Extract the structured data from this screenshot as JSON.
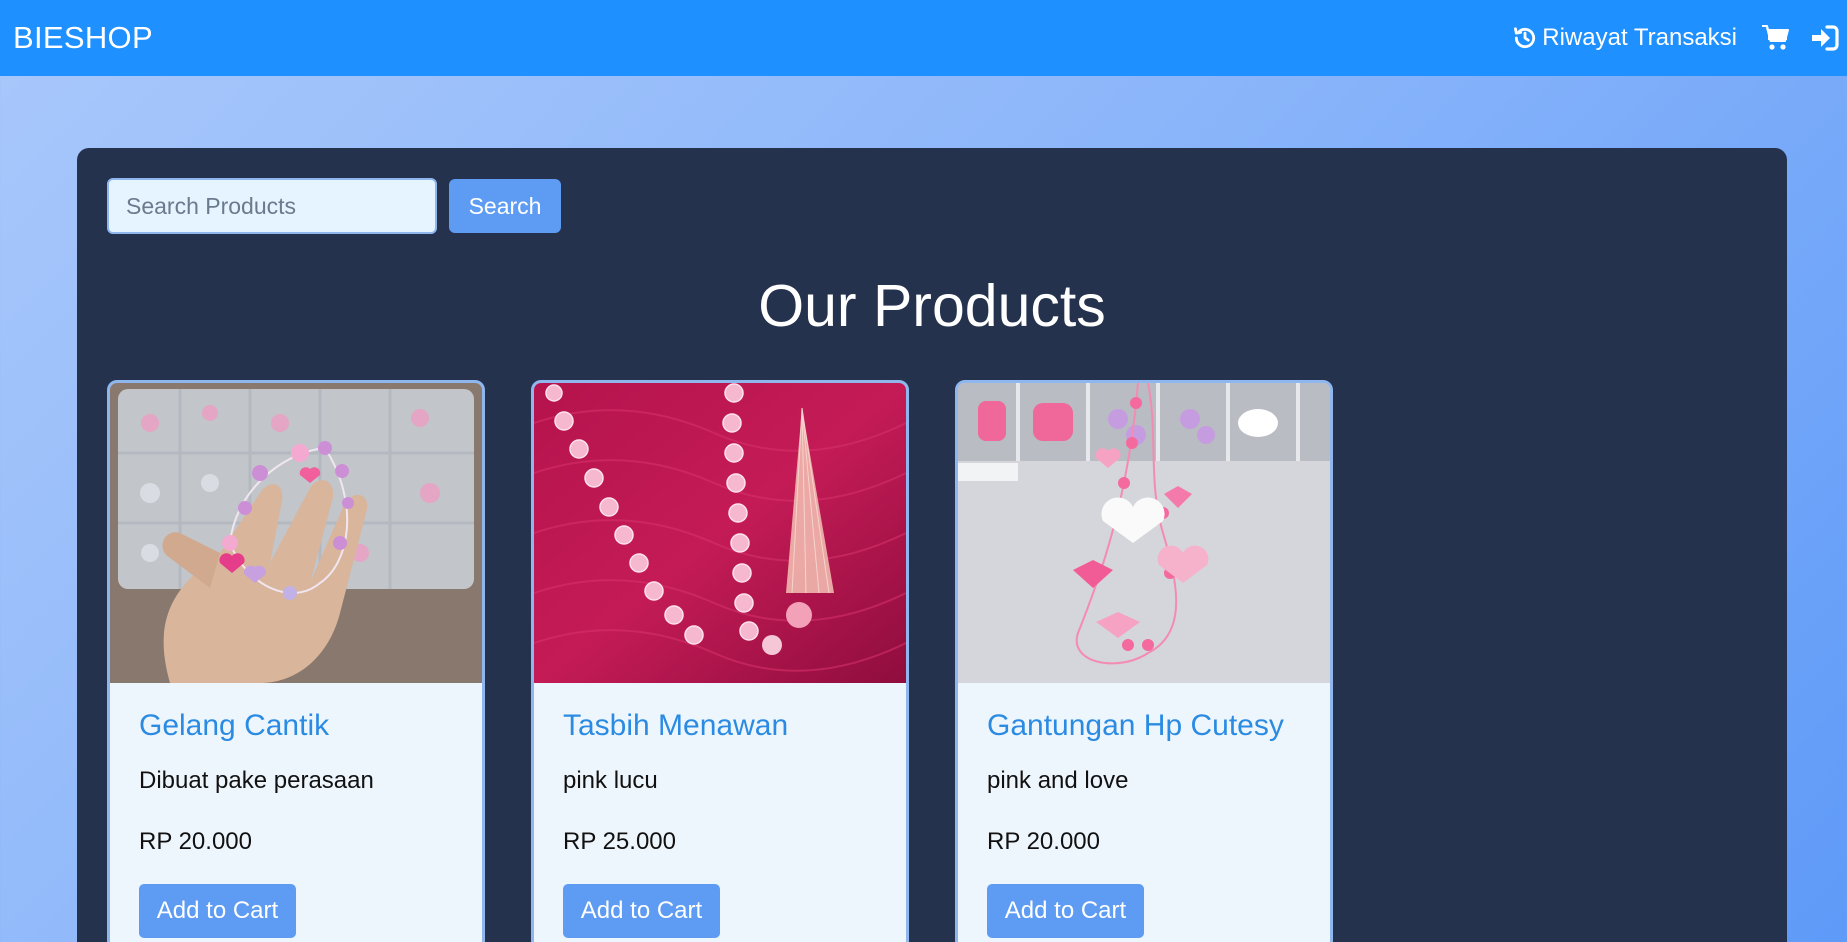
{
  "navbar": {
    "brand": "BIESHOP",
    "history_label": "Riwayat Transaksi",
    "history_icon": "history-icon",
    "cart_icon": "cart-icon",
    "login_icon": "sign-in-icon"
  },
  "search": {
    "placeholder": "Search Products",
    "value": "",
    "button_label": "Search"
  },
  "main": {
    "title": "Our Products"
  },
  "products": [
    {
      "name": "Gelang Cantik",
      "description": "Dibuat pake perasaan",
      "price": "RP 20.000",
      "button": "Add to Cart"
    },
    {
      "name": "Tasbih Menawan",
      "description": "pink lucu",
      "price": "RP 25.000",
      "button": "Add to Cart"
    },
    {
      "name": "Gantungan Hp Cutesy",
      "description": "pink and love",
      "price": "RP 20.000",
      "button": "Add to Cart"
    }
  ],
  "colors": {
    "navbar": "#1e90ff",
    "panel": "#24324d",
    "accent_button": "#5e9cf3",
    "product_title": "#2b8be3"
  }
}
